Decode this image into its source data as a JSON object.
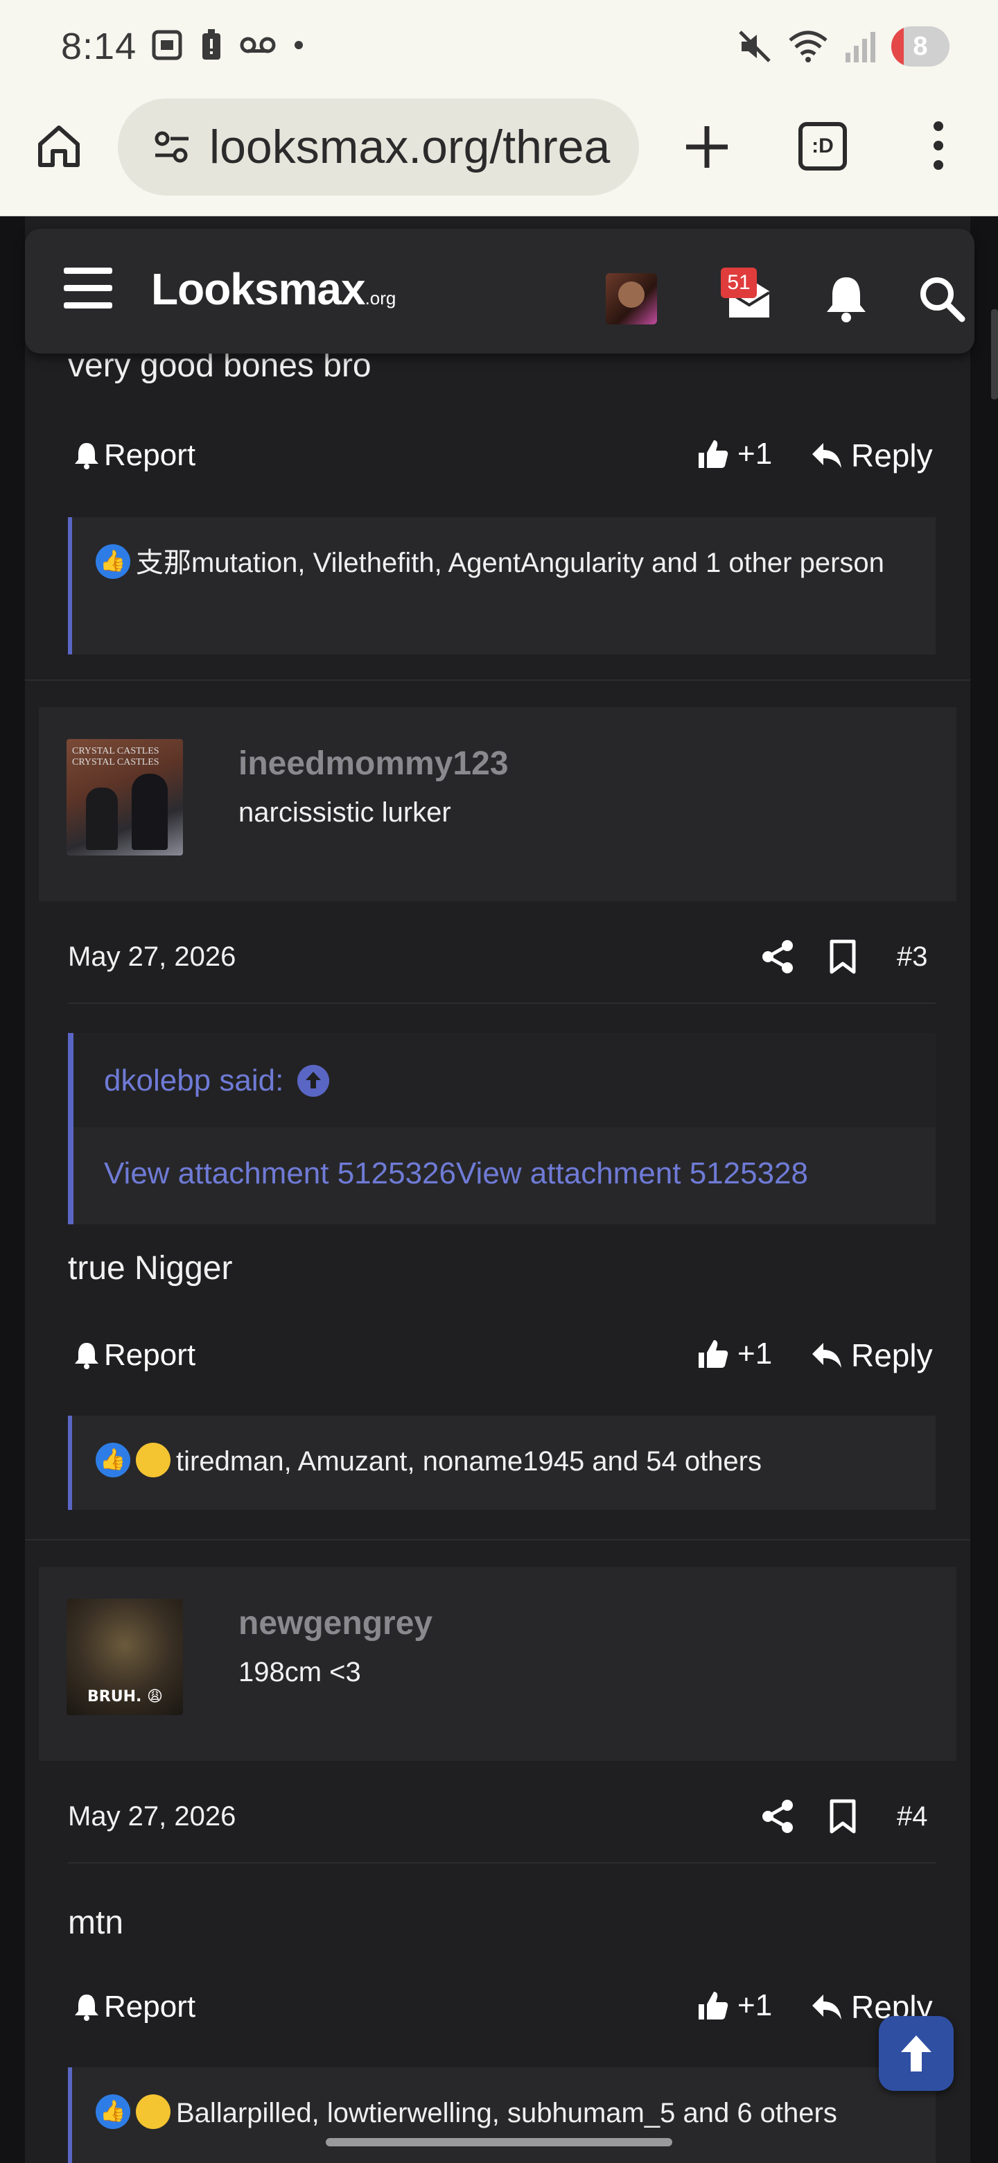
{
  "status_bar": {
    "time": "8:14",
    "battery": "8"
  },
  "browser": {
    "url": "looksmax.org/threa",
    "tabs_icon_text": ":D"
  },
  "header": {
    "logo_main": "Looksmax",
    "logo_suffix": ".org",
    "inbox_badge": "51"
  },
  "posts": [
    {
      "text": "very good bones bro",
      "report_label": "Report",
      "like_label": "+1",
      "reply_label": "Reply",
      "reactions": "支那mutation, Vilethefith, AgentAngularity and 1 other person"
    },
    {
      "user": {
        "name": "ineedmommy123",
        "title": "narcissistic lurker",
        "avatar_text": "CRYSTAL CASTLES\nCRYSTAL CASTLES"
      },
      "date": "May 27, 2026",
      "number": "#3",
      "quote": {
        "author": "dkolebp said:",
        "body": "View attachment 5125326View attachment 5125328"
      },
      "text": "true Nigger",
      "report_label": "Report",
      "like_label": "+1",
      "reply_label": "Reply",
      "reactions": "tiredman, Amuzant, noname1945 and 54 others"
    },
    {
      "user": {
        "name": "newgengrey",
        "title": "198cm <3",
        "avatar_text": "BRUH. 😩"
      },
      "date": "May 27, 2026",
      "number": "#4",
      "text": "mtn",
      "report_label": "Report",
      "like_label": "+1",
      "reply_label": "Reply",
      "reactions": "Ballarpilled, lowtierwelling, subhumam_5 and 6 others"
    }
  ],
  "colors": {
    "accent": "#5a66c4",
    "link": "#6f7bd6",
    "badge": "#e03c3c",
    "like": "#2e7de6"
  }
}
